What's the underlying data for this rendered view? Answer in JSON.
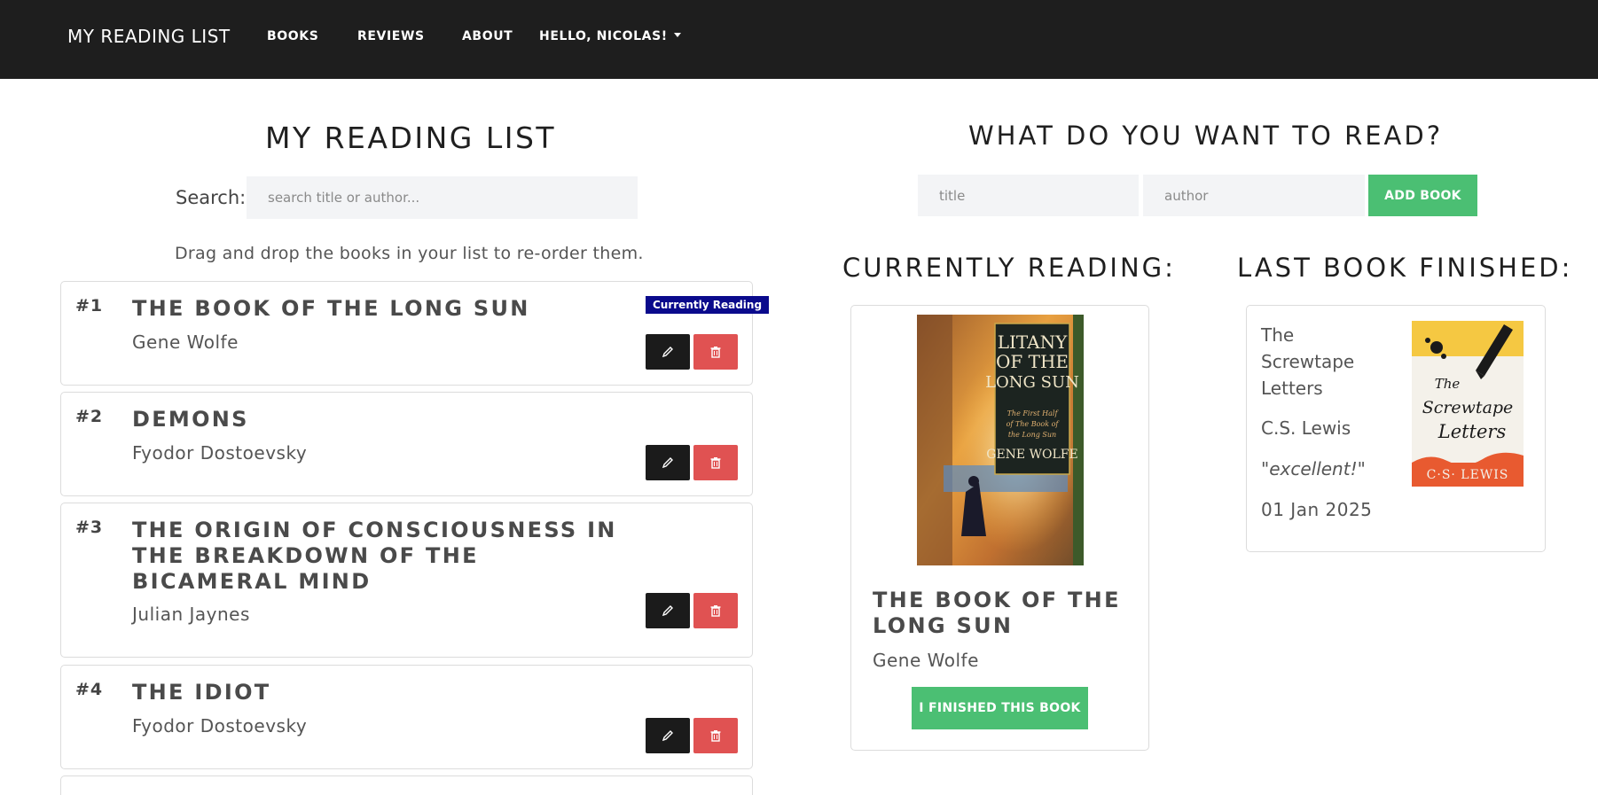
{
  "navbar": {
    "brand": "MY READING LIST",
    "links": [
      "BOOKS",
      "REVIEWS",
      "ABOUT"
    ],
    "user": "HELLO, NICOLAS!"
  },
  "reading_list": {
    "heading": "MY READING LIST",
    "search_label": "Search:",
    "search_placeholder": "search title or author...",
    "drag_hint": "Drag and drop the books in your list to re-order them.",
    "books": [
      {
        "num": "#1",
        "title": "THE BOOK OF THE LONG SUN",
        "author": "Gene Wolfe",
        "badge": "Currently Reading"
      },
      {
        "num": "#2",
        "title": "DEMONS",
        "author": "Fyodor Dostoevsky"
      },
      {
        "num": "#3",
        "title": "THE ORIGIN OF CONSCIOUSNESS IN THE BREAKDOWN OF THE BICAMERAL MIND",
        "author": "Julian Jaynes"
      },
      {
        "num": "#4",
        "title": "THE IDIOT",
        "author": "Fyodor Dostoevsky"
      }
    ]
  },
  "add_book": {
    "heading": "WHAT DO YOU WANT TO READ?",
    "title_placeholder": "title",
    "author_placeholder": "author",
    "button": "ADD BOOK"
  },
  "currently_reading": {
    "heading": "CURRENTLY READING:",
    "title": "THE BOOK OF THE LONG SUN",
    "author": "Gene Wolfe",
    "button": "I FINISHED THIS BOOK",
    "cover": {
      "line1": "LITANY",
      "line2": "OF THE",
      "line3": "LONG SUN",
      "sub1": "The First Half",
      "sub2": "of The Book of",
      "sub3": "the Long Sun",
      "author": "GENE WOLFE"
    }
  },
  "last_finished": {
    "heading": "LAST BOOK FINISHED:",
    "title": "The Screwtape Letters",
    "author": "C.S. Lewis",
    "review": "\"excellent!\"",
    "date": "01 Jan 2025",
    "cover": {
      "line1": "The",
      "line2": "Screwtape",
      "line3": "Letters",
      "author": "C·S· LEWIS"
    }
  },
  "colors": {
    "navbar": "#1e1e1e",
    "green": "#4bbf73",
    "delete": "#e05252",
    "edit": "#1b1b1b",
    "badge": "#0a0a8c"
  }
}
